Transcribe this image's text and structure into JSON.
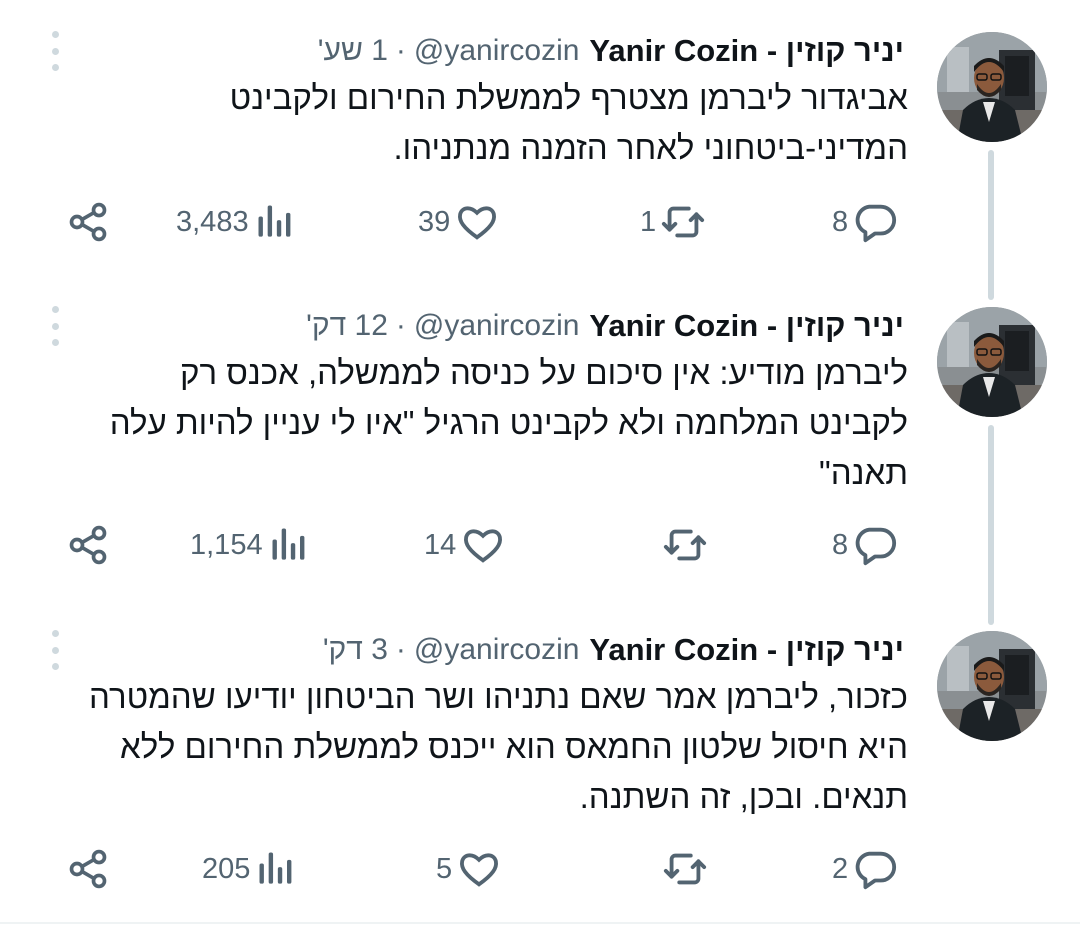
{
  "tweets": [
    {
      "name": "יניר קוזין - Yanir Cozin",
      "handle": "@yanircozin",
      "separator": "·",
      "time": "1 שע'",
      "text_lines": [
        "אביגדור ליברמן מצטרף לממשלת החירום ולקבינט",
        "המדיני-ביטחוני לאחר הזמנה מנתניהו."
      ],
      "replies": "8",
      "retweets": "1",
      "likes": "39",
      "views": "3,483"
    },
    {
      "name": "יניר קוזין - Yanir Cozin",
      "handle": "@yanircozin",
      "separator": "·",
      "time": "12 דק'",
      "text_lines": [
        "ליברמן מודיע:  אין סיכום על כניסה לממשלה, אכנס רק",
        "לקבינט המלחמה ולא לקבינט הרגיל \"איו לי עניין להיות עלה",
        "תאנה\""
      ],
      "replies": "8",
      "retweets": "",
      "likes": "14",
      "views": "1,154"
    },
    {
      "name": "יניר קוזין - Yanir Cozin",
      "handle": "@yanircozin",
      "separator": "·",
      "time": "3 דק'",
      "text_lines": [
        "כזכור, ליברמן אמר שאם נתניהו ושר הביטחון יודיעו שהמטרה",
        "היא חיסול שלטון החמאס הוא ייכנס לממשלת החירום ללא",
        "תנאים. ובכן, זה השתנה."
      ],
      "replies": "2",
      "retweets": "",
      "likes": "5",
      "views": "205"
    }
  ],
  "icons": {
    "avatar": "user-avatar-photo",
    "reply": "reply-icon",
    "retweet": "retweet-icon",
    "like": "heart-icon",
    "views": "views-icon",
    "share": "share-icon",
    "more": "more-options-icon"
  },
  "colors": {
    "text": "#0f1419",
    "secondary": "#536471",
    "thread_line": "#cfd9de"
  }
}
